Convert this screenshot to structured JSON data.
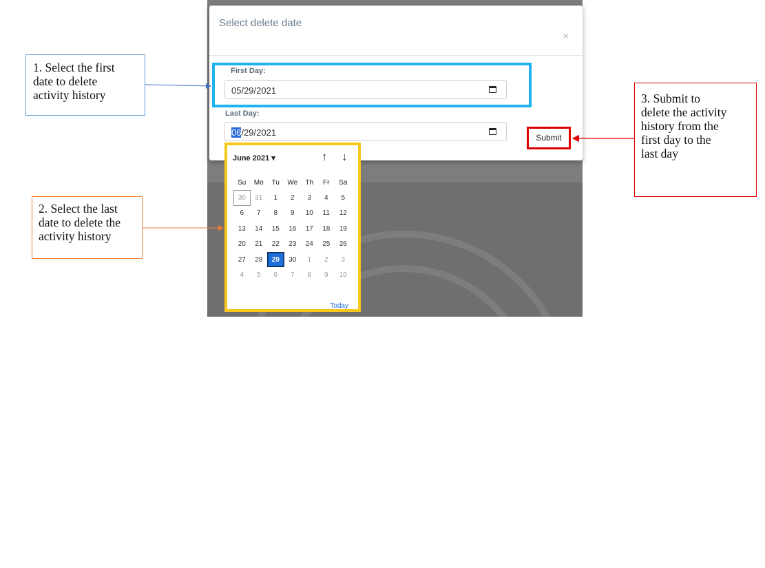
{
  "modal": {
    "title": "Select delete date",
    "close_label": "×",
    "first_day": {
      "label": "First Day:",
      "value": "05/29/2021"
    },
    "last_day": {
      "label": "Last Day:",
      "value_selected_part": "06",
      "value_rest": "/29/2021"
    },
    "submit_label": "Submit"
  },
  "calendar": {
    "month_label": "June 2021 ▾",
    "prev_icon": "↑",
    "next_icon": "↓",
    "weekdays": [
      "Su",
      "Mo",
      "Tu",
      "We",
      "Th",
      "Fr",
      "Sa"
    ],
    "weeks": [
      [
        "30",
        "31",
        "1",
        "2",
        "3",
        "4",
        "5"
      ],
      [
        "6",
        "7",
        "8",
        "9",
        "10",
        "11",
        "12"
      ],
      [
        "13",
        "14",
        "15",
        "16",
        "17",
        "18",
        "19"
      ],
      [
        "20",
        "21",
        "22",
        "23",
        "24",
        "25",
        "26"
      ],
      [
        "27",
        "28",
        "29",
        "30",
        "1",
        "2",
        "3"
      ],
      [
        "4",
        "5",
        "6",
        "7",
        "8",
        "9",
        "10"
      ]
    ],
    "selected_day": "29",
    "today_label": "Today"
  },
  "callouts": {
    "step1": [
      "1. Select the first",
      "date to delete",
      "activity history"
    ],
    "step2": [
      "2. Select the last",
      "date to delete the",
      "activity history"
    ],
    "step3": [
      "3. Submit to",
      "delete the activity",
      "history from the",
      "first day to the",
      "last day"
    ]
  },
  "colors": {
    "step1_border": "#5b9bd5",
    "step2_border": "#ed7d31",
    "step3_border": "#e00000",
    "first_day_highlight": "#1fb2ef",
    "calendar_highlight": "#f8c71c",
    "selected_date": "#1e6fd9"
  }
}
